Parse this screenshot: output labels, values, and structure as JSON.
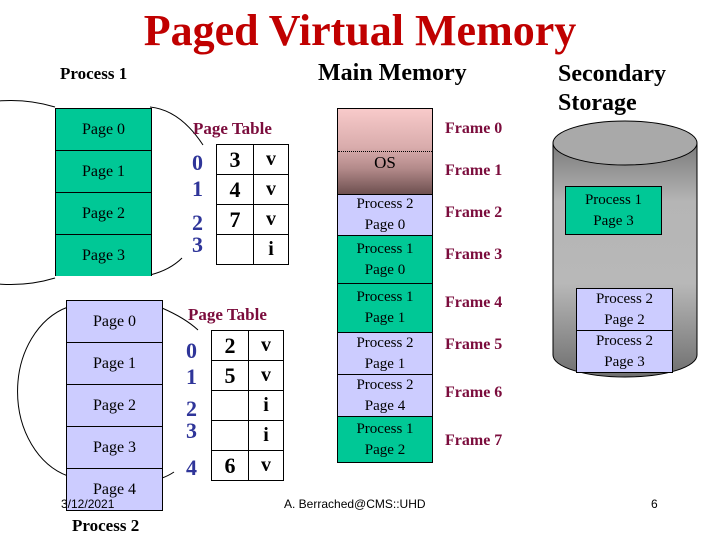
{
  "title": "Paged Virtual Memory",
  "labels": {
    "process1": "Process 1",
    "process2": "Process 2",
    "main_memory": "Main Memory",
    "secondary_storage_line1": "Secondary",
    "secondary_storage_line2": "Storage"
  },
  "colors": {
    "title": "#c00000",
    "process1_fill": "#00c896",
    "process2_fill": "#ccccff",
    "frame_label": "#7b0c3c",
    "page_index": "#2f3599"
  },
  "process1": {
    "pages": [
      "Page 0",
      "Page 1",
      "Page 2",
      "Page 3"
    ],
    "page_table": {
      "title": "Page Table",
      "rows": [
        {
          "index": "0",
          "frame": "3",
          "bit": "v"
        },
        {
          "index": "1",
          "frame": "4",
          "bit": "v"
        },
        {
          "index": "2",
          "frame": "7",
          "bit": "v"
        },
        {
          "index": "3",
          "frame": "",
          "bit": "i"
        }
      ]
    }
  },
  "process2": {
    "pages": [
      "Page 0",
      "Page 1",
      "Page 2",
      "Page 3",
      "Page 4"
    ],
    "page_table": {
      "title": "Page Table",
      "rows": [
        {
          "index": "0",
          "frame": "2",
          "bit": "v"
        },
        {
          "index": "1",
          "frame": "5",
          "bit": "v"
        },
        {
          "index": "2",
          "frame": "",
          "bit": "i"
        },
        {
          "index": "3",
          "frame": "",
          "bit": "i"
        },
        {
          "index": "4",
          "frame": "6",
          "bit": "v"
        }
      ]
    }
  },
  "main_memory": {
    "os_label": "OS",
    "frames": [
      {
        "label": "Frame 0",
        "content": [
          "OS"
        ]
      },
      {
        "label": "Frame 1",
        "content": [
          "OS"
        ]
      },
      {
        "label": "Frame 2",
        "content": [
          "Process 2",
          "Page 0"
        ],
        "owner": "process2"
      },
      {
        "label": "Frame 3",
        "content": [
          "Process 1",
          "Page 0"
        ],
        "owner": "process1"
      },
      {
        "label": "Frame 4",
        "content": [
          "Process 1",
          "Page 1"
        ],
        "owner": "process1"
      },
      {
        "label": "Frame 5",
        "content": [
          "Process 2",
          "Page 1"
        ],
        "owner": "process2"
      },
      {
        "label": "Frame 6",
        "content": [
          "Process 2",
          "Page 4"
        ],
        "owner": "process2"
      },
      {
        "label": "Frame 7",
        "content": [
          "Process 1",
          "Page 2"
        ],
        "owner": "process1"
      }
    ]
  },
  "secondary_storage": {
    "items": [
      {
        "line1": "Process 1",
        "line2": "Page 3",
        "owner": "process1"
      },
      {
        "line1": "Process 2",
        "line2": "Page 2",
        "owner": "process2"
      },
      {
        "line1": "Process 2",
        "line2": "Page 3",
        "owner": "process2"
      }
    ]
  },
  "footer": {
    "date": "3/12/2021",
    "author": "A. Berrached@CMS::UHD",
    "page_number": "6"
  }
}
